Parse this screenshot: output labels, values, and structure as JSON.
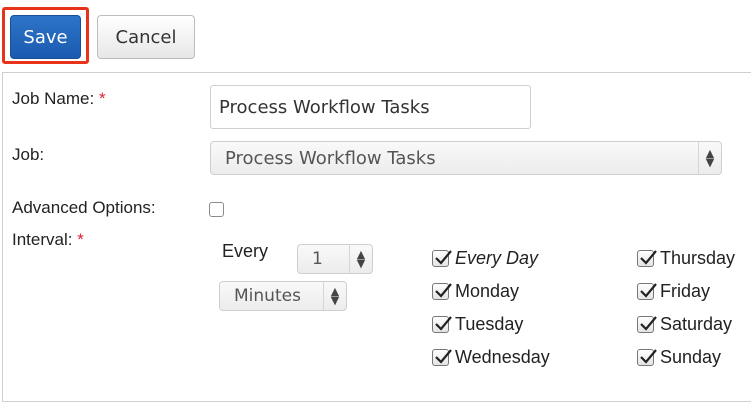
{
  "toolbar": {
    "save_label": "Save",
    "cancel_label": "Cancel"
  },
  "form": {
    "job_name_label": "Job Name:",
    "job_name_value": "Process Workflow Tasks",
    "job_label": "Job:",
    "job_value": "Process Workflow Tasks",
    "advanced_label": "Advanced Options:",
    "interval_label": "Interval:",
    "required_mark": "*",
    "every_label": "Every",
    "every_value": "1",
    "unit_value": "Minutes"
  },
  "days": [
    {
      "label": "Every Day",
      "checked": true
    },
    {
      "label": "Monday",
      "checked": true
    },
    {
      "label": "Tuesday",
      "checked": true
    },
    {
      "label": "Wednesday",
      "checked": true
    },
    {
      "label": "Thursday",
      "checked": true
    },
    {
      "label": "Friday",
      "checked": true
    },
    {
      "label": "Saturday",
      "checked": true
    },
    {
      "label": "Sunday",
      "checked": true
    }
  ],
  "colors": {
    "primary": "#1a5bb0",
    "highlight": "#e8331a",
    "required": "#dd2233"
  }
}
